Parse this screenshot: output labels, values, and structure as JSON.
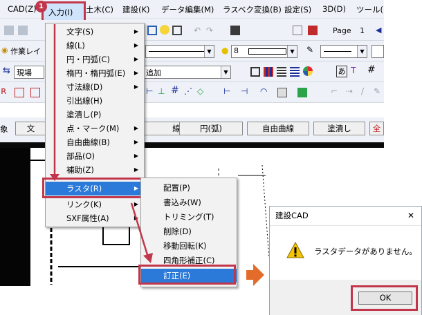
{
  "menubar": {
    "items": [
      "CAD(Z)",
      "入力(I)",
      "土木(C)",
      "建設(K)",
      "データ編集(M)",
      "ラスベク変換(B)",
      "設定(S)",
      "3D(D)",
      "ツール("
    ],
    "step_number": "1"
  },
  "toolbar1": {
    "page_label": "Page",
    "page_value": "1"
  },
  "toolbar2": {
    "layer_label": "作業レイ",
    "color_value": "8"
  },
  "toolbar3": {
    "layer2_label": "現場",
    "mode_label": "追加",
    "text_icon": "あ"
  },
  "command_buttons": [
    "線",
    "円(弧)",
    "自由曲線",
    "塗潰し",
    "全"
  ],
  "left_stub": {
    "label_a": "象",
    "label_b": "文"
  },
  "input_menu": {
    "items": [
      {
        "label": "文字(S)",
        "submenu": true
      },
      {
        "label": "線(L)",
        "submenu": true
      },
      {
        "label": "円・円弧(C)",
        "submenu": true
      },
      {
        "label": "楕円・楕円弧(E)",
        "submenu": true
      },
      {
        "label": "寸法線(D)",
        "submenu": true
      },
      {
        "label": "引出線(H)",
        "submenu": false
      },
      {
        "label": "塗潰し(P)",
        "submenu": false
      },
      {
        "label": "点・マーク(M)",
        "submenu": true
      },
      {
        "label": "自由曲線(B)",
        "submenu": true
      },
      {
        "label": "部品(O)",
        "submenu": true
      },
      {
        "label": "補助(Z)",
        "submenu": true
      },
      {
        "label": "ラスタ(R)",
        "submenu": true
      },
      {
        "label": "リンク(K)",
        "submenu": true
      },
      {
        "label": "SXF属性(A)",
        "submenu": true
      }
    ]
  },
  "raster_submenu": {
    "items": [
      "配置(P)",
      "書込み(W)",
      "トリミング(T)",
      "削除(D)",
      "移動回転(K)",
      "四角形補正(C)",
      "訂正(E)"
    ]
  },
  "dialog": {
    "title": "建設CAD",
    "message": "ラスタデータがありません。",
    "ok_label": "OK",
    "close_glyph": "✕"
  },
  "colors": {
    "highlight": "#2b79d8",
    "annotation_red": "#c1364a",
    "arrow_orange": "#e46c2a",
    "menubar_bg": "#eef1f7"
  }
}
